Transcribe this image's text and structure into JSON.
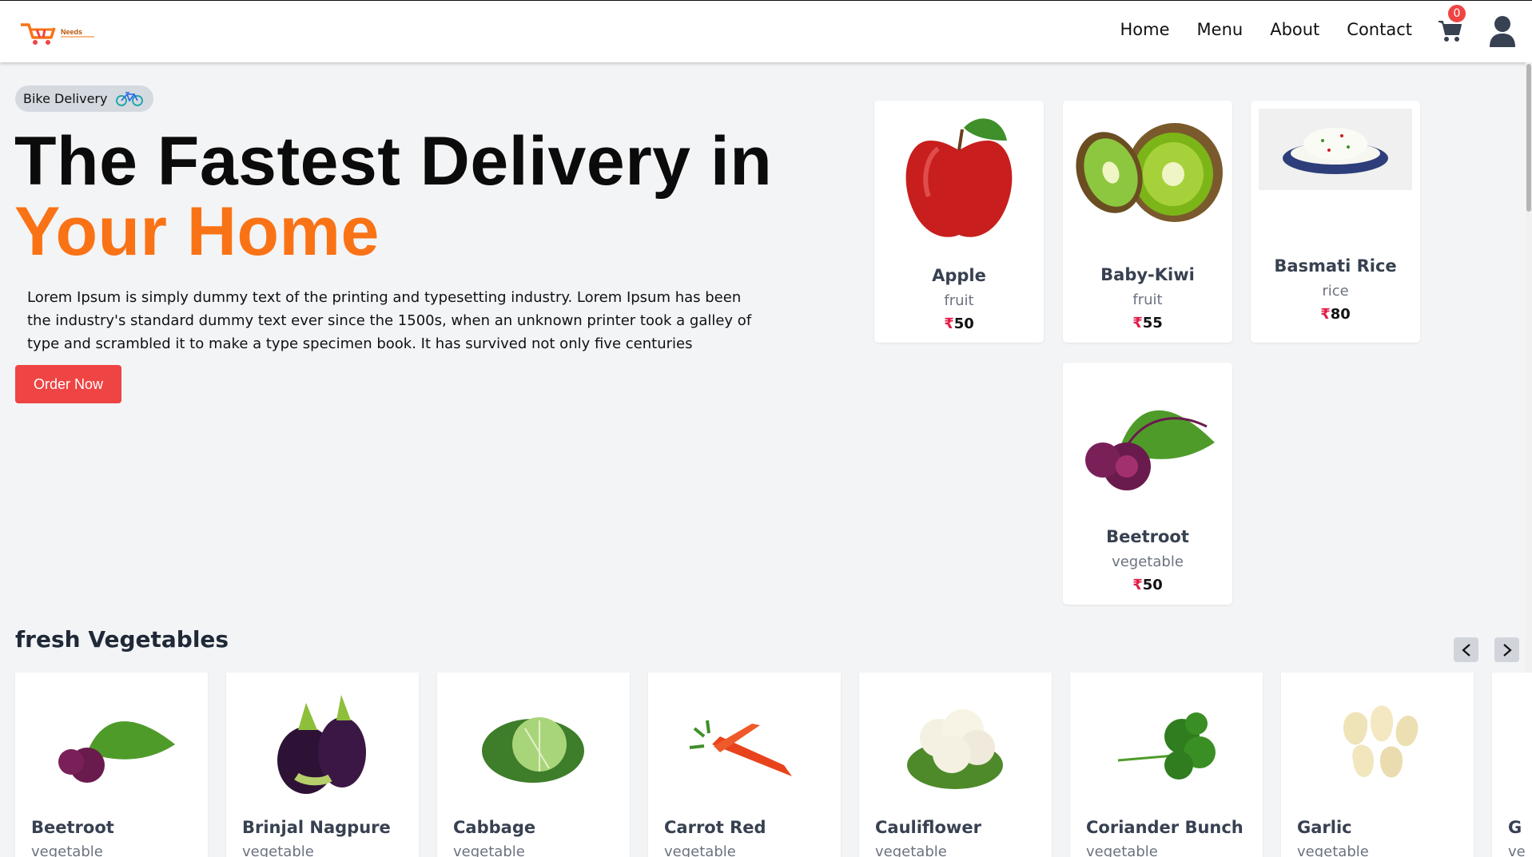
{
  "header": {
    "logo_text": "Needs",
    "nav": [
      "Home",
      "Menu",
      "About",
      "Contact"
    ],
    "cart_count": "0"
  },
  "hero": {
    "pill_label": "Bike Delivery",
    "title_line1": "The Fastest Delivery in",
    "title_line2": "Your Home",
    "description": "Lorem Ipsum is simply dummy text of the printing and typesetting industry. Lorem Ipsum has been the industry's standard dummy text ever since the 1500s, when an unknown printer took a galley of type and scrambled it to make a type specimen book. It has survived not only five centuries",
    "order_button": "Order Now"
  },
  "featured": [
    {
      "name": "Apple",
      "category": "fruit",
      "currency": "₹",
      "price": "50",
      "icon": "apple-image"
    },
    {
      "name": "Baby-Kiwi",
      "category": "fruit",
      "currency": "₹",
      "price": "55",
      "icon": "kiwi-image"
    },
    {
      "name": "Basmati Rice",
      "category": "rice",
      "currency": "₹",
      "price": "80",
      "icon": "rice-image"
    },
    {
      "name": "Beetroot",
      "category": "vegetable",
      "currency": "₹",
      "price": "50",
      "icon": "beetroot-image"
    }
  ],
  "section": {
    "title": "fresh Vegetables",
    "prev_icon": "chevron-left-icon",
    "next_icon": "chevron-right-icon"
  },
  "vegetables": [
    {
      "name": "Beetroot",
      "category": "vegetable"
    },
    {
      "name": "Brinjal Nagpure",
      "category": "vegetable"
    },
    {
      "name": "Cabbage",
      "category": "vegetable"
    },
    {
      "name": "Carrot Red",
      "category": "vegetable"
    },
    {
      "name": "Cauliflower",
      "category": "vegetable"
    },
    {
      "name": "Coriander Bunch",
      "category": "vegetable"
    },
    {
      "name": "Garlic",
      "category": "vegetable"
    },
    {
      "name": "G",
      "category": "ve"
    }
  ],
  "colors": {
    "accent": "#f97316",
    "button": "#ef4444",
    "rupee": "#e11d48",
    "background": "#f3f4f6"
  }
}
